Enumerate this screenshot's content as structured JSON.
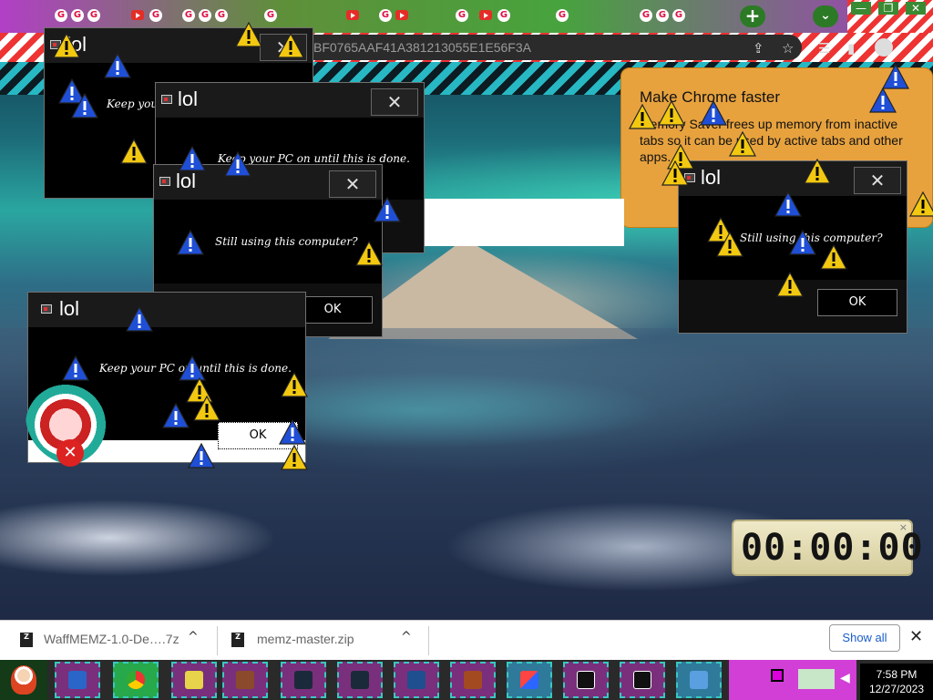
{
  "browser": {
    "address_text": "BF0765AAF41A381213055E1E56F3A",
    "new_tab_symbol": "+",
    "tab_search_symbol": "⌄",
    "window_controls": [
      "—",
      "❐",
      "✕"
    ]
  },
  "promo": {
    "title": "Make Chrome faster",
    "body": "Memory Saver frees up memory from inactive tabs so it can be used by active tabs and other apps."
  },
  "dialogs": [
    {
      "caption": "lol",
      "message": "Keep your PC on until this is done.",
      "ok_label": ""
    },
    {
      "caption": "lol",
      "message": "Keep your PC on until this is done.",
      "ok_label": ""
    },
    {
      "caption": "lol",
      "message": "Still using this computer?",
      "ok_label": "OK"
    },
    {
      "caption": "lol",
      "message": "Keep your PC on until this is done.",
      "ok_label": "OK"
    },
    {
      "caption": "lol",
      "message": "Still using this computer?",
      "ok_label": "OK"
    }
  ],
  "close_glyph": "✕",
  "clock_widget": {
    "display": "00:00:00",
    "close": "×"
  },
  "downloads": {
    "items": [
      {
        "name": "WaffMEMZ-1.0-De….7z",
        "chevron": "^"
      },
      {
        "name": "memz-master.zip",
        "chevron": "^"
      }
    ],
    "show_all": "Show all",
    "close": "✕"
  },
  "taskbar": {
    "time": "7:58 PM",
    "date": "12/27/2023"
  },
  "colors": {
    "promo_bg": "#e7a23e",
    "dialog_bg": "#000000",
    "warning_yellow": "#f2c811",
    "warning_blue": "#1f4fd6",
    "taskbar_button": "#7a2f7c"
  },
  "icons": {
    "warning_yellow": "warning-icon",
    "warning_blue": "warning-blue-icon",
    "error": "error-icon"
  }
}
